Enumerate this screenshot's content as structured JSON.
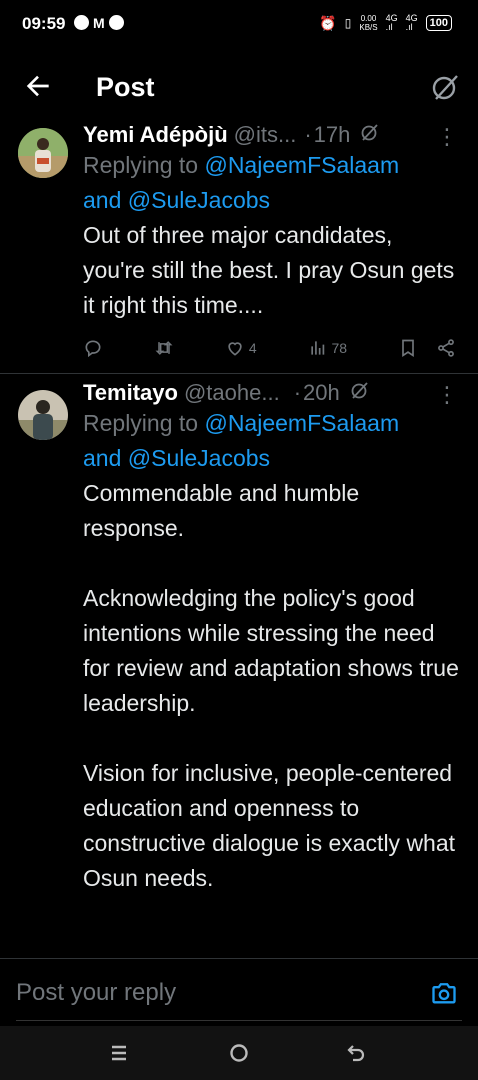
{
  "status_bar": {
    "time": "09:59",
    "net_speed_value": "0.00",
    "net_speed_unit": "KB/S",
    "signal1": "4G",
    "signal2": "4G",
    "battery": "100"
  },
  "header": {
    "title": "Post"
  },
  "tweets": [
    {
      "name": "Yemi Adépòjù",
      "handle": "@its...",
      "separator": "·",
      "time_ago": "17h",
      "reply_prefix": "Replying to",
      "mention1": "@NajeemFSalaam",
      "mention_join": "and",
      "mention2": "@SuleJacobs",
      "text": "Out of three major candidates, you're still the best. I pray Osun gets it right this time....",
      "likes": "4",
      "views": "78"
    },
    {
      "name": "Temitayo",
      "handle": "@taohe...",
      "separator": "·",
      "time_ago": "20h",
      "reply_prefix": "Replying to",
      "mention1": "@NajeemFSalaam",
      "mention_join": "and",
      "mention2": "@SuleJacobs",
      "text": "Commendable and humble response.\n\nAcknowledging the policy's good intentions while stressing the need for review and adaptation shows true leadership.\n\nVision for inclusive, people-centered education and openness to constructive dialogue is exactly what Osun needs."
    }
  ],
  "composer": {
    "placeholder": "Post your reply"
  },
  "colors": {
    "background": "#000000",
    "text": "#e7e9ea",
    "muted": "#71767b",
    "accent": "#1d9bf0"
  },
  "icons": [
    "back-arrow-icon",
    "grok-icon",
    "verified-icon",
    "more-icon",
    "reply-icon",
    "retweet-icon",
    "like-icon",
    "views-icon",
    "bookmark-icon",
    "share-icon",
    "camera-icon",
    "menu-icon",
    "home-icon",
    "back-nav-icon"
  ]
}
